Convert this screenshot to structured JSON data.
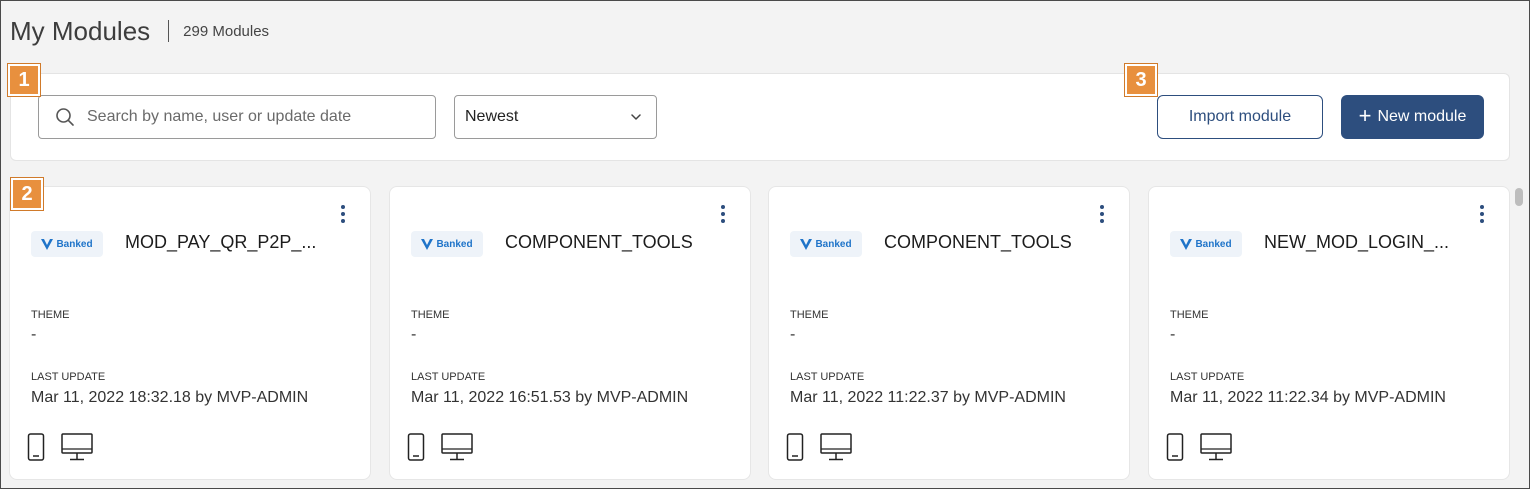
{
  "header": {
    "title": "My Modules",
    "count": "299 Modules"
  },
  "toolbar": {
    "search_placeholder": "Search by name, user or update date",
    "sort_value": "Newest",
    "import_label": "Import module",
    "new_label": "New module"
  },
  "callouts": [
    "1",
    "2",
    "3"
  ],
  "labels": {
    "theme": "THEME",
    "last_update": "LAST UPDATE"
  },
  "cards": [
    {
      "brand": "Banked",
      "name": "MOD_PAY_QR_P2P_...",
      "theme": "-",
      "last_update": "Mar 11, 2022 18:32.18 by MVP-ADMIN"
    },
    {
      "brand": "Banked",
      "name": "COMPONENT_TOOLS",
      "theme": "-",
      "last_update": "Mar 11, 2022 16:51.53 by MVP-ADMIN"
    },
    {
      "brand": "Banked",
      "name": "COMPONENT_TOOLS",
      "theme": "-",
      "last_update": "Mar 11, 2022 11:22.37 by MVP-ADMIN"
    },
    {
      "brand": "Banked",
      "name": "NEW_MOD_LOGIN_...",
      "theme": "-",
      "last_update": "Mar 11, 2022 11:22.34 by MVP-ADMIN"
    }
  ],
  "icons": {
    "search": "search-icon",
    "chevron": "chevron-down-icon",
    "plus": "plus-icon",
    "kebab": "kebab-menu-icon",
    "mobile": "mobile-device-icon",
    "desktop": "desktop-device-icon",
    "brand": "banked-logo-icon"
  },
  "colors": {
    "primary": "#2d4e7e",
    "callout": "#e8903e",
    "brand": "#1f74c9",
    "background": "#f3f3f3"
  }
}
